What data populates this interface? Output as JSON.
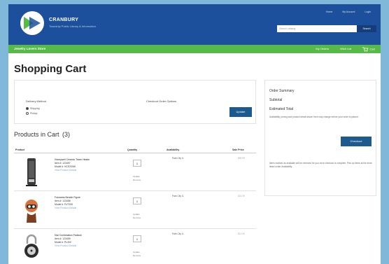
{
  "header": {
    "brand_name": "CRANBURY",
    "brand_tagline": "Township Public Library & Information",
    "top_links": [
      "Home",
      "My Account",
      "Login"
    ],
    "search_placeholder": "Search catalog",
    "search_button": "Search",
    "colors": {
      "header": "#1c4f9c",
      "nav": "#57b947"
    }
  },
  "nav": {
    "title": "Jewelry Lovers Store",
    "links": [
      "My Orders",
      "Wish List"
    ],
    "cart_label": "Cart"
  },
  "page_title": "Shopping Cart",
  "delivery": {
    "method_label": "Delivery Method",
    "options": [
      "Shipping",
      "Pickup"
    ],
    "selected_option": "Shipping",
    "store_label": "Checkout Order Options",
    "update_button": "Update"
  },
  "products": {
    "title": "Products in Cart",
    "count": "(3)",
    "columns": [
      "Product",
      "Quantity",
      "Availability",
      "Sale Price"
    ],
    "rows": [
      {
        "name": "Honeywell Ceramic Tower Heater",
        "sku": "Item #: 123457",
        "model": "Model #: HCE200W",
        "qty": "1",
        "availability": "Park City IL",
        "price": "$59.99",
        "qty_links": [
          "Update",
          "Remove"
        ]
      },
      {
        "name": "Futurama Bender Figure",
        "sku": "Item #: 123458",
        "model": "Model #: FUT200",
        "qty": "1",
        "availability": "Park City IL",
        "price": "$24.99",
        "qty_links": [
          "Update",
          "Remove"
        ]
      },
      {
        "name": "Dial Combination Padlock",
        "sku": "Item #: 123459",
        "model": "Model #: PL300",
        "qty": "1",
        "availability": "Park City IL",
        "price": "$12.99",
        "qty_links": [
          "Update",
          "Remove"
        ]
      }
    ],
    "detail_link": "View Product Details"
  },
  "summary": {
    "title": "Order Summary",
    "subtotal_label": "Subtotal",
    "estimated_label": "Estimated Total",
    "note": "Availability, pricing and product detail shown here may change before your order is placed.",
    "checkout_button": "Checkout",
    "footer_note": "Items marked as available will be reserved for you once checkout is complete. Pick up items at the store listed under Availability."
  }
}
